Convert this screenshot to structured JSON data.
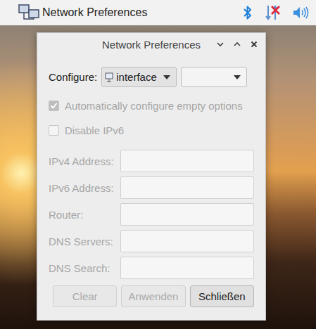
{
  "taskbar": {
    "app": {
      "title": "Network Preferences"
    },
    "tray": [
      {
        "kind": "bluetooth"
      },
      {
        "kind": "network",
        "connected": false
      },
      {
        "kind": "volume"
      }
    ]
  },
  "window": {
    "title": "Network Preferences",
    "controls": [
      {
        "kind": "minimize"
      },
      {
        "kind": "maximize"
      },
      {
        "kind": "close"
      }
    ]
  },
  "configure": {
    "label": "Configure:",
    "selects": [
      {
        "kind": "interface",
        "value": "interface"
      },
      {
        "kind": "blank",
        "value": ""
      }
    ]
  },
  "options": [
    {
      "label": "Automatically configure empty options",
      "checked": true,
      "disabled": true
    },
    {
      "label": "Disable IPv6",
      "checked": false,
      "disabled": true
    }
  ],
  "fields": [
    {
      "label": "IPv4 Address:",
      "value": "",
      "disabled": true
    },
    {
      "label": "IPv6 Address:",
      "value": "",
      "disabled": true
    },
    {
      "label": "Router:",
      "value": "",
      "disabled": true
    },
    {
      "label": "DNS Servers:",
      "value": "",
      "disabled": true
    },
    {
      "label": "DNS Search:",
      "value": "",
      "disabled": true
    }
  ],
  "buttons": [
    {
      "label": "Clear",
      "disabled": true
    },
    {
      "label": "Anwenden",
      "disabled": true
    },
    {
      "label": "Schließen",
      "disabled": false
    }
  ]
}
